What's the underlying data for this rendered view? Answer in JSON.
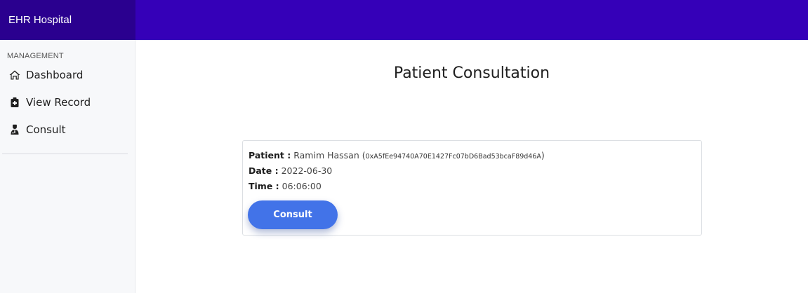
{
  "brand": {
    "title": "EHR Hospital"
  },
  "colors": {
    "brand_bg": "#2a008f",
    "topbar_bg": "#3500b8",
    "button": "#4273e8"
  },
  "sidebar": {
    "section_label": "MANAGEMENT",
    "items": [
      {
        "label": "Dashboard",
        "icon": "home-icon"
      },
      {
        "label": "View Record",
        "icon": "medical-record-icon"
      },
      {
        "label": "Consult",
        "icon": "doctor-icon"
      }
    ]
  },
  "main": {
    "title": "Patient Consultation",
    "consultation": {
      "patient_label": "Patient :",
      "patient_name": "Ramim Hassan",
      "patient_address": "0xA5fEe94740A70E1427Fc07bD6Bad53bcaF89d46A",
      "date_label": "Date :",
      "date_value": "2022-06-30",
      "time_label": "Time :",
      "time_value": "06:06:00",
      "button_label": "Consult"
    }
  }
}
